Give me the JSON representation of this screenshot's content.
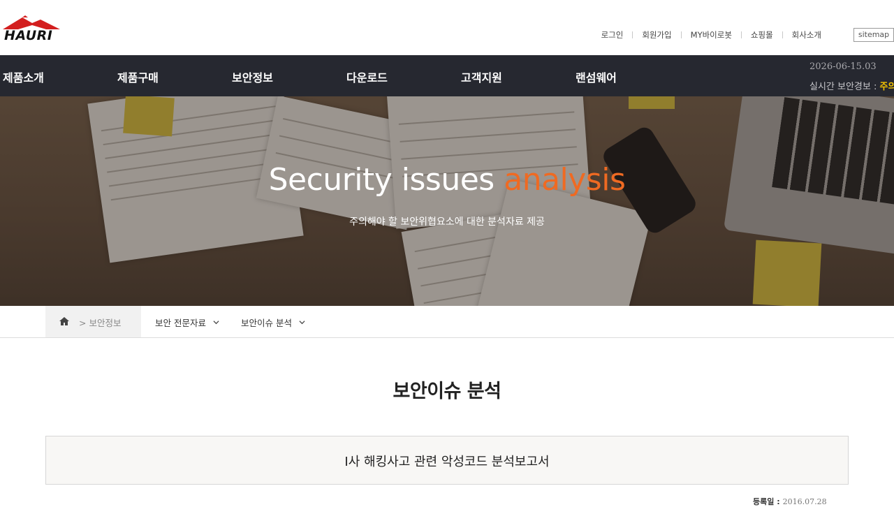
{
  "brand": {
    "logo_text": "HAURI"
  },
  "util_links": [
    "로그인",
    "회원가입",
    "MY바이로봇",
    "쇼핑몰",
    "회사소개"
  ],
  "sitemap_label": "sitemap",
  "nav": {
    "items": [
      "제품소개",
      "제품구매",
      "보안정보",
      "다운로드",
      "고객지원",
      "랜섬웨어"
    ],
    "date": "2026-06-15.03",
    "alert_label": "실시간 보안경보 :",
    "alert_level": "주의"
  },
  "hero": {
    "title_main": "Security issues",
    "title_accent": "analysis",
    "subtitle": "주의해야 할 보안위협요소에 대한 분석자료 제공"
  },
  "breadcrumb": {
    "home_label": "> 보안정보",
    "dropdown_1": "보안 전문자료",
    "dropdown_2": "보안이슈 분석"
  },
  "page_title": "보안이슈 분석",
  "article": {
    "title": "I사 해킹사고 관련 악성코드 분석보고서",
    "date_label": "등록일 :",
    "date_value": "2016.07.28"
  },
  "colors": {
    "nav_bg": "#262830",
    "accent": "#ef6a22",
    "alert": "#f2c200"
  }
}
